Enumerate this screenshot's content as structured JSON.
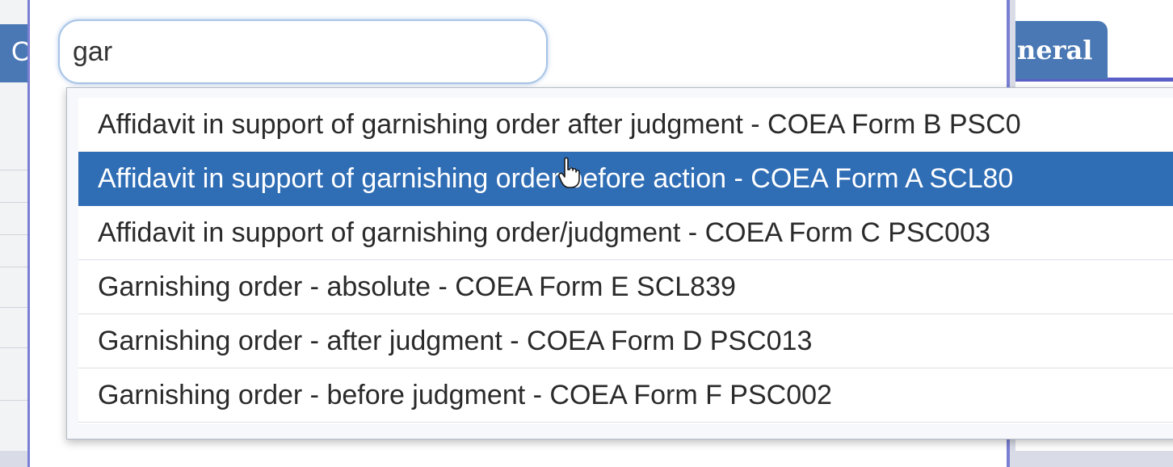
{
  "background": {
    "tab_label": "neral",
    "left_glyph": "O"
  },
  "search": {
    "value": "gar",
    "placeholder": ""
  },
  "dropdown": {
    "items": [
      {
        "label": "Affidavit in support of garnishing order after judgment - COEA Form B PSC0",
        "selected": false
      },
      {
        "label": "Affidavit in support of garnishing order before action - COEA Form A SCL80",
        "selected": true
      },
      {
        "label": "Affidavit in support of garnishing order/judgment - COEA Form C PSC003",
        "selected": false
      },
      {
        "label": "Garnishing order - absolute - COEA Form E SCL839",
        "selected": false
      },
      {
        "label": "Garnishing order - after judgment - COEA Form D PSC013",
        "selected": false
      },
      {
        "label": "Garnishing order - before judgment - COEA Form F PSC002",
        "selected": false
      }
    ]
  },
  "colors": {
    "accent": "#2f6db5",
    "tab": "#4a78b4",
    "modal_border": "#7a7fd4"
  },
  "cursor": "hand-pointer-icon"
}
